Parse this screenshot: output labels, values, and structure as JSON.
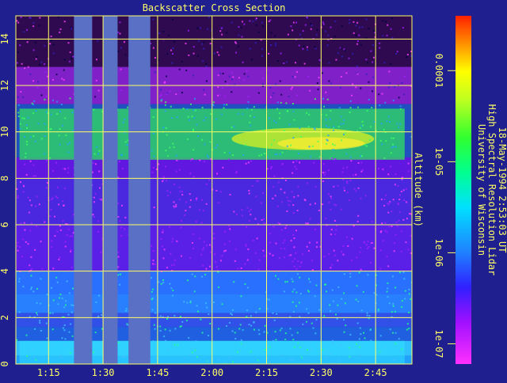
{
  "chart_data": {
    "type": "heatmap",
    "title": "Backscatter Cross Section",
    "ylabel": "Altitude (km)",
    "xlabel": "",
    "x_ticks": [
      "1:15",
      "1:30",
      "1:45",
      "2:00",
      "2:15",
      "2:30",
      "2:45"
    ],
    "x_range_minutes": [
      66,
      175
    ],
    "y_ticks": [
      "0",
      "2",
      "4",
      "6",
      "8",
      "10",
      "12",
      "14"
    ],
    "ylim": [
      0,
      15
    ],
    "grid": true,
    "colorbar": {
      "scale": "log",
      "range": [
        6e-08,
        0.0004
      ],
      "tick_labels": [
        "0.0001",
        "1e-05",
        "1e-06",
        "1e-07"
      ],
      "tick_values": [
        0.0001,
        1e-05,
        1e-06,
        1e-07
      ]
    },
    "data_gaps_minutes": [
      [
        82,
        87
      ],
      [
        90,
        94
      ],
      [
        97,
        103
      ]
    ],
    "layers": [
      {
        "feature": "cirrus",
        "base_km": 8.8,
        "top_km": 11.0,
        "start": "1:07",
        "end": "2:53",
        "peak_backscatter": 1e-05
      },
      {
        "feature": "boundary layer",
        "base_km": 0.0,
        "top_km": 1.0,
        "start": "1:07",
        "end": "2:53",
        "peak_backscatter": 3e-06
      }
    ],
    "annotation": [
      "University of Wisconsin",
      "High Spectral Resolution Lidar",
      "18-May-1994  2:53:03 UT"
    ]
  },
  "colors": {
    "background": "#1f1f8f",
    "axes": "#ffff66",
    "gap": "#5a70c4"
  }
}
